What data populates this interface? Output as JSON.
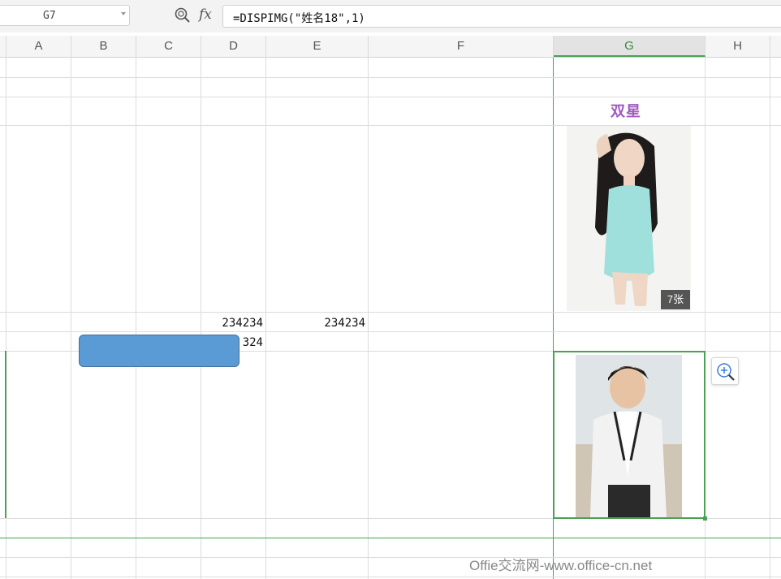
{
  "formula_bar": {
    "name_box": "G7",
    "fx_label": "fx",
    "formula": "=DISPIMG(\"姓名18\",1)"
  },
  "columns": [
    "A",
    "B",
    "C",
    "D",
    "E",
    "F",
    "G",
    "H"
  ],
  "selected_column": "G",
  "cells": {
    "D9": "234234",
    "E9": "234234",
    "D10": "324"
  },
  "images": {
    "woman_caption": "7张",
    "woman_logo": "双星"
  },
  "watermark": "Offie交流网-www.office-cn.net",
  "colors": {
    "selection": "#4ca056",
    "shape_fill": "#5b9bd5"
  }
}
